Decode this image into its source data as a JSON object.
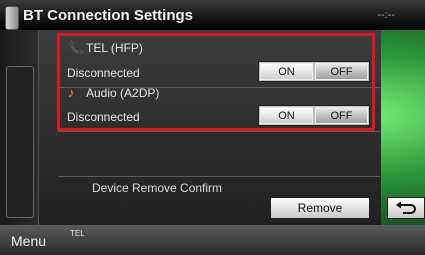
{
  "header": {
    "title": "BT Connection Settings",
    "right_text": "--:--"
  },
  "devices": [
    {
      "name": "TEL (HFP)",
      "status": "Disconnected",
      "on_label": "ON",
      "off_label": "OFF",
      "icon": "phone-handset-icon"
    },
    {
      "name": "Audio (A2DP)",
      "status": "Disconnected",
      "on_label": "ON",
      "off_label": "OFF",
      "icon": "music-note-icon"
    }
  ],
  "remove": {
    "label": "Device Remove Confirm",
    "button_label": "Remove"
  },
  "footer": {
    "menu_label": "Menu",
    "tel_label": "TEL"
  },
  "colors": {
    "highlight": "#e0161c",
    "tel_icon": "#39d13a",
    "audio_icon": "#f39c1f"
  }
}
